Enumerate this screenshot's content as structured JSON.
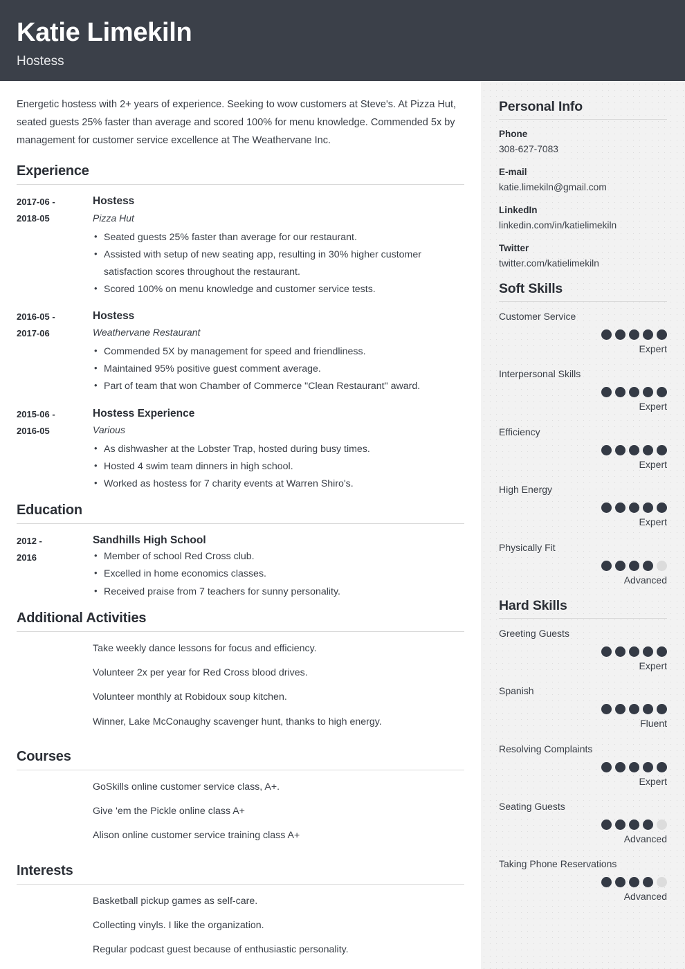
{
  "header": {
    "name": "Katie Limekiln",
    "role": "Hostess",
    "bg_color": "#3b4049"
  },
  "summary": "Energetic hostess with 2+ years of experience. Seeking to wow customers at Steve's. At Pizza Hut, seated guests 25% faster than average and scored 100% for menu knowledge. Commended 5x by management for customer service excellence at The Weathervane Inc.",
  "sections": {
    "experience": {
      "title": "Experience",
      "entries": [
        {
          "dates": "2017-06 - 2018-05",
          "date_from": "2017-06 -",
          "date_to": "2018-05",
          "title": "Hostess",
          "subtitle": "Pizza Hut",
          "bullets": [
            "Seated guests 25% faster than average for our restaurant.",
            "Assisted with setup of new seating app, resulting in 30% higher customer satisfaction scores throughout the restaurant.",
            "Scored 100% on menu knowledge and customer service tests."
          ]
        },
        {
          "dates": "2016-05 - 2017-06",
          "date_from": "2016-05 -",
          "date_to": "2017-06",
          "title": "Hostess",
          "subtitle": "Weathervane Restaurant",
          "bullets": [
            "Commended 5X by management for speed and friendliness.",
            "Maintained 95% positive guest comment average.",
            "Part of team that won Chamber of Commerce \"Clean Restaurant\" award."
          ]
        },
        {
          "dates": "2015-06 - 2016-05",
          "date_from": "2015-06 -",
          "date_to": "2016-05",
          "title": "Hostess Experience",
          "subtitle": "Various",
          "bullets": [
            "As dishwasher at the Lobster Trap, hosted during busy times.",
            "Hosted 4 swim team dinners in high school.",
            "Worked as hostess for 7 charity events at Warren Shiro's."
          ]
        }
      ]
    },
    "education": {
      "title": "Education",
      "entries": [
        {
          "dates": "2012 - 2016",
          "date_from": "2012 -",
          "date_to": "2016",
          "title": "Sandhills High School",
          "bullets": [
            "Member of school Red Cross club.",
            "Excelled in home economics classes.",
            "Received praise from 7 teachers for sunny personality."
          ]
        }
      ]
    },
    "additional_activities": {
      "title": "Additional Activities",
      "items": [
        "Take weekly dance lessons for focus and efficiency.",
        "Volunteer 2x per year for Red Cross blood drives.",
        "Volunteer monthly at Robidoux soup kitchen.",
        "Winner, Lake McConaughy scavenger hunt, thanks to high energy."
      ]
    },
    "courses": {
      "title": "Courses",
      "items": [
        "GoSkills online customer service class, A+.",
        "Give 'em the Pickle online class A+",
        "Alison online customer service training class A+"
      ]
    },
    "interests": {
      "title": "Interests",
      "items": [
        "Basketball pickup games as self-care.",
        "Collecting vinyls. I like the organization.",
        "Regular podcast guest because of enthusiastic personality."
      ]
    }
  },
  "sidebar": {
    "personal_info": {
      "title": "Personal Info",
      "items": [
        {
          "label": "Phone",
          "value": "308-627-7083"
        },
        {
          "label": "E-mail",
          "value": "katie.limekiln@gmail.com"
        },
        {
          "label": "LinkedIn",
          "value": "linkedin.com/in/katielimekiln"
        },
        {
          "label": "Twitter",
          "value": "twitter.com/katielimekiln"
        }
      ]
    },
    "soft_skills": {
      "title": "Soft Skills",
      "max_dots": 5,
      "skills": [
        {
          "name": "Customer Service",
          "filled": 5,
          "level": "Expert"
        },
        {
          "name": "Interpersonal Skills",
          "filled": 5,
          "level": "Expert"
        },
        {
          "name": "Efficiency",
          "filled": 5,
          "level": "Expert"
        },
        {
          "name": "High Energy",
          "filled": 5,
          "level": "Expert"
        },
        {
          "name": "Physically Fit",
          "filled": 4,
          "level": "Advanced"
        }
      ]
    },
    "hard_skills": {
      "title": "Hard Skills",
      "max_dots": 5,
      "skills": [
        {
          "name": "Greeting Guests",
          "filled": 5,
          "level": "Expert"
        },
        {
          "name": "Spanish",
          "filled": 5,
          "level": "Fluent"
        },
        {
          "name": "Resolving Complaints",
          "filled": 5,
          "level": "Expert"
        },
        {
          "name": "Seating Guests",
          "filled": 4,
          "level": "Advanced"
        },
        {
          "name": "Taking Phone Reservations",
          "filled": 4,
          "level": "Advanced"
        }
      ]
    },
    "dot_colors": {
      "filled": "#343a45",
      "empty": "#dcdcdc"
    }
  }
}
